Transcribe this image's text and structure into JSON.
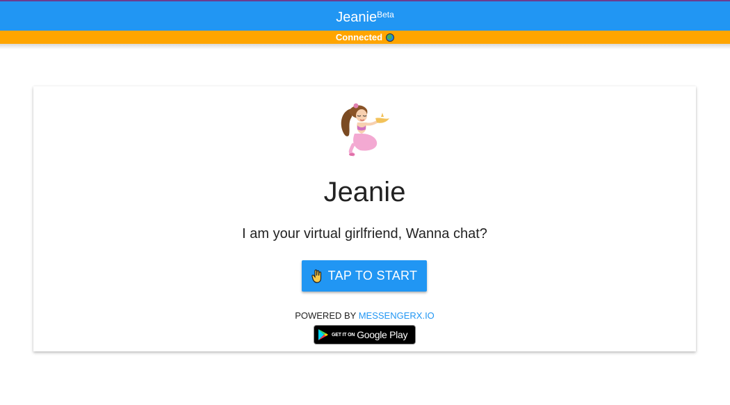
{
  "header": {
    "title": "Jeanie",
    "badge": "Beta",
    "status_text": "Connected",
    "status_icon": "globe-icon",
    "colors": {
      "primary": "#2196f3",
      "status": "#ffa500"
    }
  },
  "card": {
    "avatar_icon": "genie-girl-avatar",
    "name": "Jeanie",
    "tagline": "I am your virtual girlfriend, Wanna chat?",
    "start_button": {
      "icon": "hand-icon",
      "label": "TAP TO START"
    },
    "powered_by": {
      "prefix": "POWERED BY",
      "link_text": "MESSENGERX.IO"
    },
    "store_badge": {
      "small_text": "GET IT ON",
      "big_text": "Google Play"
    }
  }
}
